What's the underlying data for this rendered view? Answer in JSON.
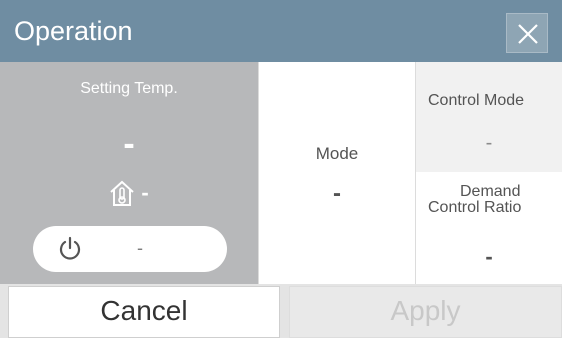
{
  "titlebar": {
    "title": "Operation",
    "close_icon": "close-icon"
  },
  "setting": {
    "label": "Setting Temp.",
    "value": "-",
    "indoor_icon": "house-thermometer-icon",
    "indoor_value": "-",
    "power_icon": "power-icon",
    "power_value": "-"
  },
  "mode": {
    "label": "Mode",
    "value": "-"
  },
  "control_mode": {
    "label": "Control Mode",
    "value": "-"
  },
  "demand": {
    "label_line1": "Demand",
    "label_line2": "Control Ratio",
    "value": "-"
  },
  "footer": {
    "cancel_label": "Cancel",
    "apply_label": "Apply"
  },
  "colors": {
    "titlebar": "#6f8da2",
    "left_panel": "#b7b8ba",
    "apply_disabled_text": "#c8c8c8"
  }
}
